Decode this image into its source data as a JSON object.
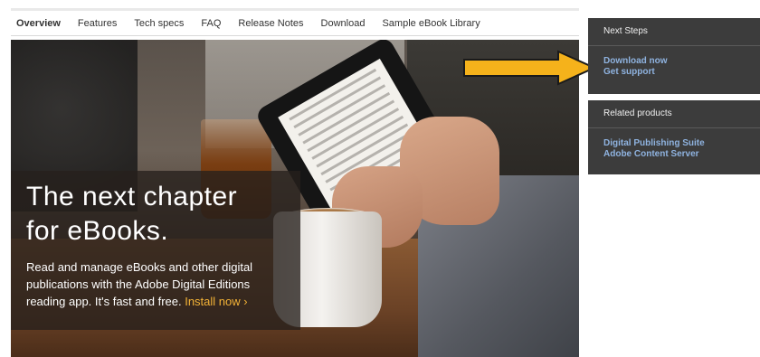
{
  "tabs": [
    "Overview",
    "Features",
    "Tech specs",
    "FAQ",
    "Release Notes",
    "Download",
    "Sample eBook Library"
  ],
  "hero": {
    "headline_1": "The next chapter",
    "headline_2": "for eBooks.",
    "desc_1": "Read and manage eBooks and other digital",
    "desc_2": "publications with the Adobe Digital Editions",
    "desc_3": "reading app. It's fast and free.",
    "install_link": "Install now ›"
  },
  "next_steps": {
    "title": "Next Steps",
    "links": [
      "Download now",
      "Get support"
    ]
  },
  "related": {
    "title": "Related products",
    "links": [
      "Digital Publishing Suite",
      "Adobe Content Server"
    ]
  },
  "colors": {
    "accent_link": "#8fb3e0",
    "install_link": "#f3b237",
    "arrow": "#f5b21b",
    "panel_bg": "#3c3c3c"
  },
  "icons": [
    "right-arrow-icon"
  ]
}
